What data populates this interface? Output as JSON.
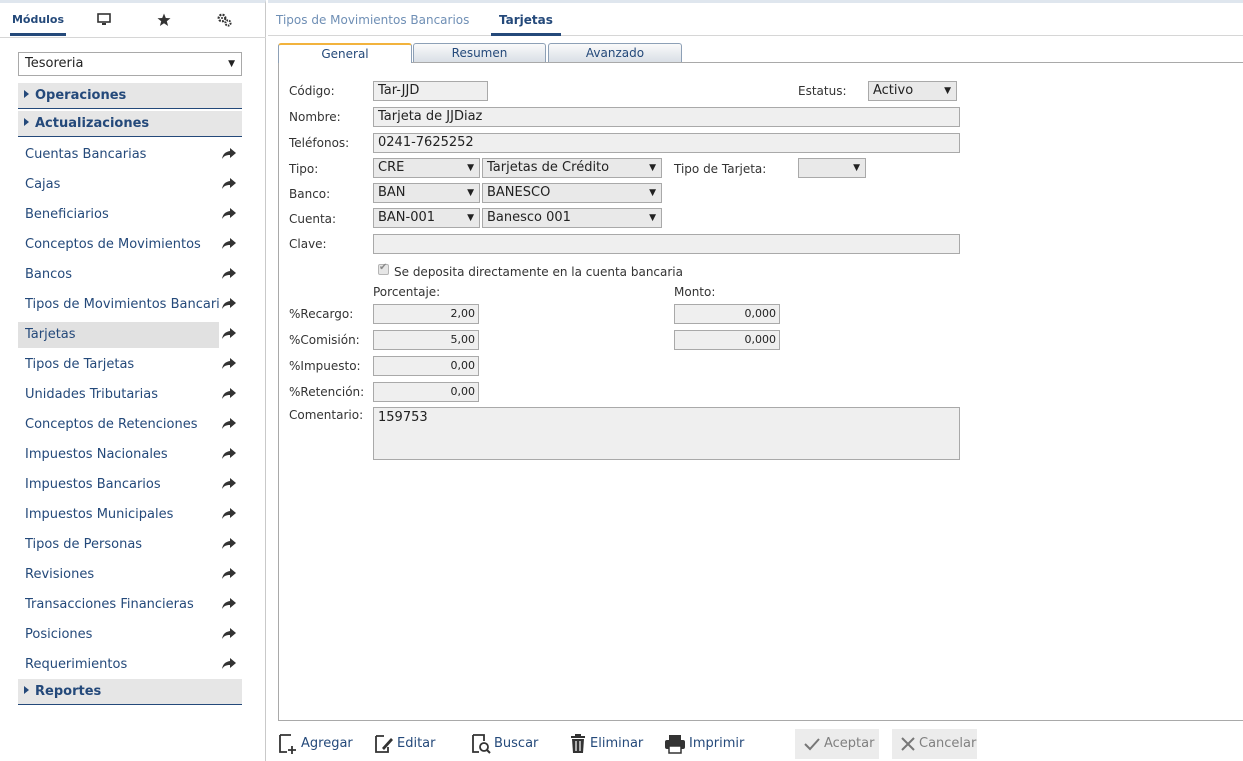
{
  "sidebar": {
    "tabs": {
      "modules_label": "Módulos"
    },
    "module_select": {
      "value": "Tesoreria"
    },
    "sections": {
      "operaciones": "Operaciones",
      "actualizaciones": "Actualizaciones",
      "reportes": "Reportes"
    },
    "items": [
      {
        "label": "Cuentas Bancarias"
      },
      {
        "label": "Cajas"
      },
      {
        "label": "Beneficiarios"
      },
      {
        "label": "Conceptos de Movimientos"
      },
      {
        "label": "Bancos"
      },
      {
        "label": "Tipos de Movimientos Bancarios"
      },
      {
        "label": "Tarjetas",
        "selected": true
      },
      {
        "label": "Tipos de Tarjetas"
      },
      {
        "label": "Unidades Tributarias"
      },
      {
        "label": "Conceptos de Retenciones"
      },
      {
        "label": "Impuestos Nacionales"
      },
      {
        "label": "Impuestos Bancarios"
      },
      {
        "label": "Impuestos Municipales"
      },
      {
        "label": "Tipos de Personas"
      },
      {
        "label": "Revisiones"
      },
      {
        "label": "Transacciones Financieras"
      },
      {
        "label": "Posiciones"
      },
      {
        "label": "Requerimientos"
      }
    ]
  },
  "doc_tabs": [
    {
      "label": "Tipos de Movimientos Bancarios",
      "active": false
    },
    {
      "label": "Tarjetas",
      "active": true
    }
  ],
  "panel_tabs": [
    {
      "label": "General",
      "active": true
    },
    {
      "label": "Resumen",
      "active": false
    },
    {
      "label": "Avanzado",
      "active": false
    }
  ],
  "form": {
    "codigo": {
      "label": "Código:",
      "value": "Tar-JJD"
    },
    "estatus": {
      "label": "Estatus:",
      "value": "Activo"
    },
    "nombre": {
      "label": "Nombre:",
      "value": "Tarjeta de JJDiaz"
    },
    "telefonos": {
      "label": "Teléfonos:",
      "value": "0241-7625252"
    },
    "tipo": {
      "label": "Tipo:",
      "code": "CRE",
      "name": "Tarjetas de Crédito"
    },
    "tipo_tarjeta": {
      "label": "Tipo de Tarjeta:",
      "value": ""
    },
    "banco": {
      "label": "Banco:",
      "code": "BAN",
      "name": "BANESCO"
    },
    "cuenta": {
      "label": "Cuenta:",
      "code": "BAN-001",
      "name": "Banesco 001"
    },
    "clave": {
      "label": "Clave:",
      "value": ""
    },
    "deposita": {
      "label": "Se deposita directamente en la cuenta bancaria",
      "checked": true
    },
    "col_porcentaje": "Porcentaje:",
    "col_monto": "Monto:",
    "recargo": {
      "label": "%Recargo:",
      "pct": "2,00",
      "monto": "0,000"
    },
    "comision": {
      "label": "%Comisión:",
      "pct": "5,00",
      "monto": "0,000"
    },
    "impuesto": {
      "label": "%Impuesto:",
      "pct": "0,00"
    },
    "retencion": {
      "label": "%Retención:",
      "pct": "0,00"
    },
    "comentario": {
      "label": "Comentario:",
      "value": "159753"
    }
  },
  "toolbar": {
    "agregar": "Agregar",
    "editar": "Editar",
    "buscar": "Buscar",
    "eliminar": "Eliminar",
    "imprimir": "Imprimir",
    "aceptar": "Aceptar",
    "cancelar": "Cancelar"
  },
  "colors": {
    "accent": "#24497a",
    "active_tab_top": "#f2b33d"
  }
}
